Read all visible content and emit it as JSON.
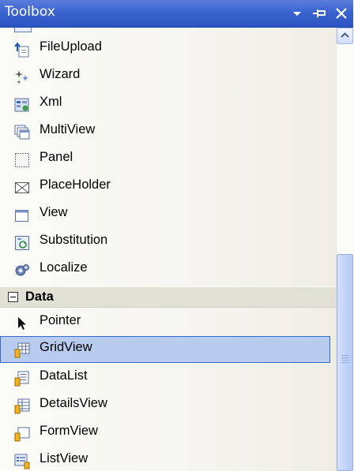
{
  "window": {
    "title": "Toolbox"
  },
  "title_buttons": {
    "dropdown_icon": "chevron-down-icon",
    "pin_icon": "pin-icon",
    "close_icon": "close-icon"
  },
  "items": [
    {
      "label": "FileUpload",
      "icon": "file-upload-icon"
    },
    {
      "label": "Wizard",
      "icon": "wizard-icon"
    },
    {
      "label": "Xml",
      "icon": "xml-icon"
    },
    {
      "label": "MultiView",
      "icon": "multiview-icon"
    },
    {
      "label": "Panel",
      "icon": "panel-icon"
    },
    {
      "label": "PlaceHolder",
      "icon": "placeholder-icon"
    },
    {
      "label": "View",
      "icon": "view-icon"
    },
    {
      "label": "Substitution",
      "icon": "substitution-icon"
    },
    {
      "label": "Localize",
      "icon": "localize-icon"
    }
  ],
  "data_group": {
    "label": "Data",
    "items": [
      {
        "label": "Pointer",
        "icon": "pointer-icon"
      },
      {
        "label": "GridView",
        "icon": "gridview-icon",
        "selected": true
      },
      {
        "label": "DataList",
        "icon": "datalist-icon"
      },
      {
        "label": "DetailsView",
        "icon": "detailsview-icon"
      },
      {
        "label": "FormView",
        "icon": "formview-icon"
      },
      {
        "label": "ListView",
        "icon": "listview-icon"
      }
    ]
  },
  "colors": {
    "title_bar": "#3b64cf",
    "selection": "#b8ccf0",
    "selection_border": "#3669c8"
  }
}
